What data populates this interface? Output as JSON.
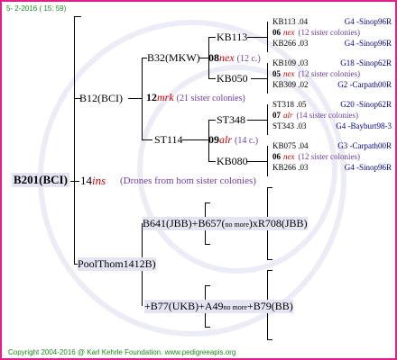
{
  "header": {
    "date": "5-  2-2016 ( 15: 59)"
  },
  "root": {
    "code": "B201(BCI)",
    "drones": {
      "count": "14",
      "race": "ins",
      "note": "(Drones from hom sister colonies)"
    }
  },
  "gen1": {
    "mother": "B12(BCI)",
    "father": "PoolThom1412B)"
  },
  "gen2": {
    "b32": "B32(MKW)",
    "b32_drones": {
      "count": "08",
      "race": "nex",
      "note": "(12 c.)"
    },
    "b12_drones": {
      "count": "12",
      "race": "mrk",
      "note": "(21 sister colonies)"
    },
    "st114": "ST114",
    "st114_drones": {
      "count": "09",
      "race": "alr",
      "note": "(14 c.)"
    }
  },
  "gen3": {
    "kb113": "KB113",
    "kb050": "KB050",
    "st348": "ST348",
    "kb080": "KB080"
  },
  "gen4": [
    {
      "code": "KB113 .04",
      "origin": "G4 -Sinop96R"
    },
    {
      "count": "06",
      "race": "nex",
      "note": "(12 sister colonies)"
    },
    {
      "code": "KB266 .03",
      "origin": "G4 -Sinop96R"
    },
    {
      "code": "KB109 .03",
      "origin": "G18 -Sinop62R"
    },
    {
      "count": "05",
      "race": "nex",
      "note": "(12 sister colonies)"
    },
    {
      "code": "KB309 .02",
      "origin": "G2 -Carpath00R"
    },
    {
      "code": "ST318 .05",
      "origin": "G20 -Sinop62R"
    },
    {
      "count": "07",
      "race": "alr",
      "note": "(14 sister colonies)"
    },
    {
      "code": "ST343 .03",
      "origin": "G4 -Bayburt98-3"
    },
    {
      "code": "KB075 .04",
      "origin": "G3 -Carpath00R"
    },
    {
      "count": "06",
      "race": "nex",
      "note": "(12 sister colonies)"
    },
    {
      "code": "KB266 .03",
      "origin": "G4 -Sinop96R"
    }
  ],
  "father_branch": {
    "b641": "B641(JBB)+B657(",
    "b641_more": "no more",
    "xr708": ")xR708(JBB)",
    "b77": "+B77(UKB)+A49",
    "b77_more": "no more",
    "b79": "+B79(BB)"
  },
  "footer": {
    "copyright": "Copyright 2004-2016 @ Karl Kehrle Foundation.",
    "site": "www.pedigreeapis.org"
  }
}
